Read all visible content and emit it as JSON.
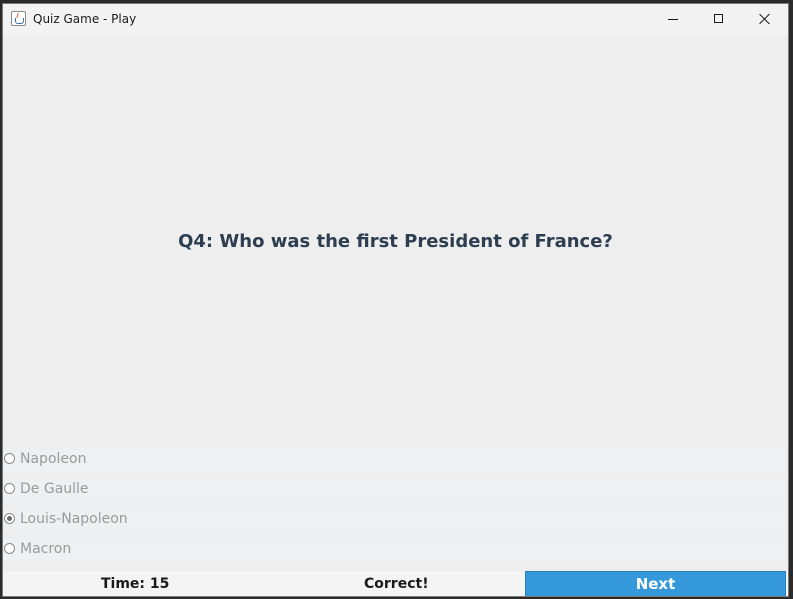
{
  "window": {
    "title": "Quiz Game - Play",
    "controls": {
      "minimize": "minimize-icon",
      "maximize": "maximize-icon",
      "close": "close-icon"
    }
  },
  "question": {
    "text": "Q4: Who was the first President of France?"
  },
  "options": [
    {
      "label": "Napoleon",
      "selected": false
    },
    {
      "label": "De Gaulle",
      "selected": false
    },
    {
      "label": "Louis-Napoleon",
      "selected": true
    },
    {
      "label": "Macron",
      "selected": false
    }
  ],
  "footer": {
    "timer": "Time: 15",
    "result": "Correct!",
    "next_label": "Next"
  },
  "colors": {
    "accent": "#3498db",
    "question_text": "#2c3e50",
    "option_text_disabled": "#9a9a9a"
  }
}
